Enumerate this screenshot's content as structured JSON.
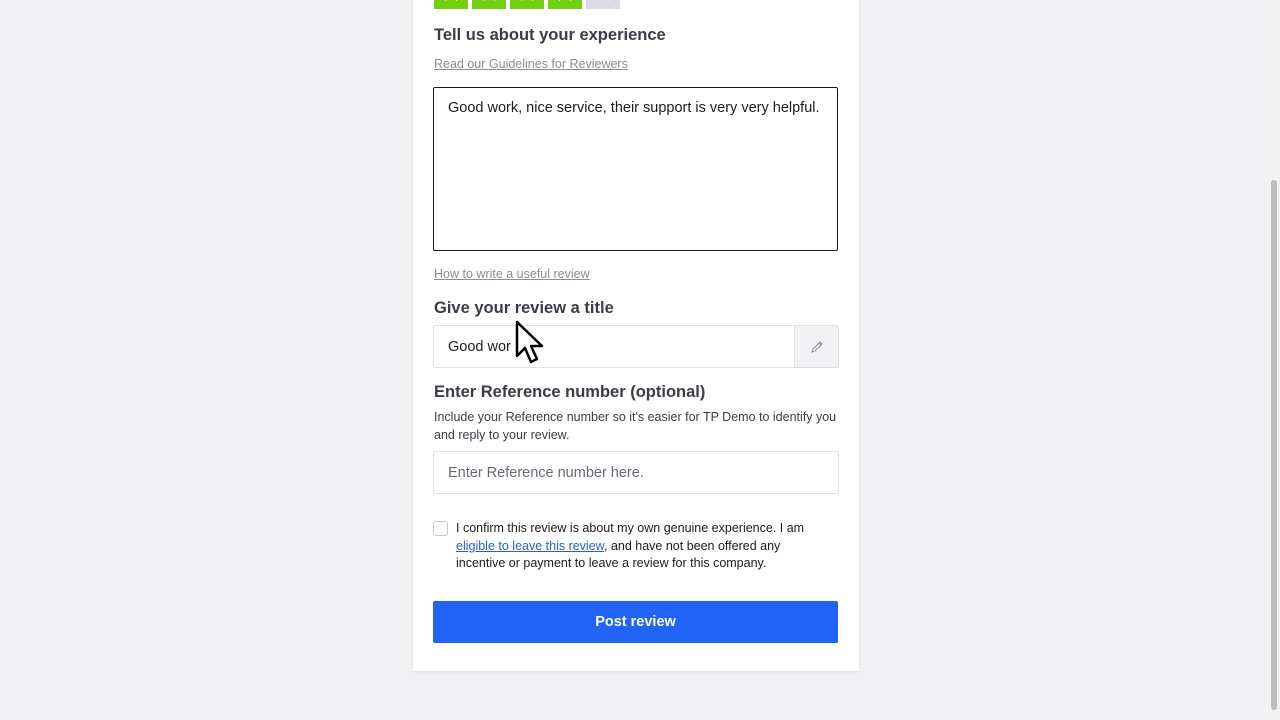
{
  "rating": {
    "value": 4,
    "max": 5,
    "filled_color": "#73cf11",
    "empty_color": "#dcdce6"
  },
  "experience": {
    "heading": "Tell us about your experience",
    "guidelines_link": "Read our Guidelines for Reviewers",
    "review_text": "Good work, nice service, their support is very very helpful.",
    "how_to_link": "How to write a useful review"
  },
  "title_section": {
    "heading": "Give your review a title",
    "value": "Good wor",
    "edit_icon": "pencil-icon"
  },
  "reference": {
    "heading": "Enter Reference number (optional)",
    "description": "Include your Reference number so it's easier for TP Demo to identify you and reply to your review.",
    "placeholder": "Enter Reference number here.",
    "value": ""
  },
  "confirm": {
    "checked": false,
    "text_before": "I confirm this review is about my own genuine experience. I am ",
    "link_text": "eligible to leave this review",
    "text_after": ", and have not been offered any incentive or payment to leave a review for this company."
  },
  "submit": {
    "label": "Post review",
    "color": "#2163f5"
  }
}
